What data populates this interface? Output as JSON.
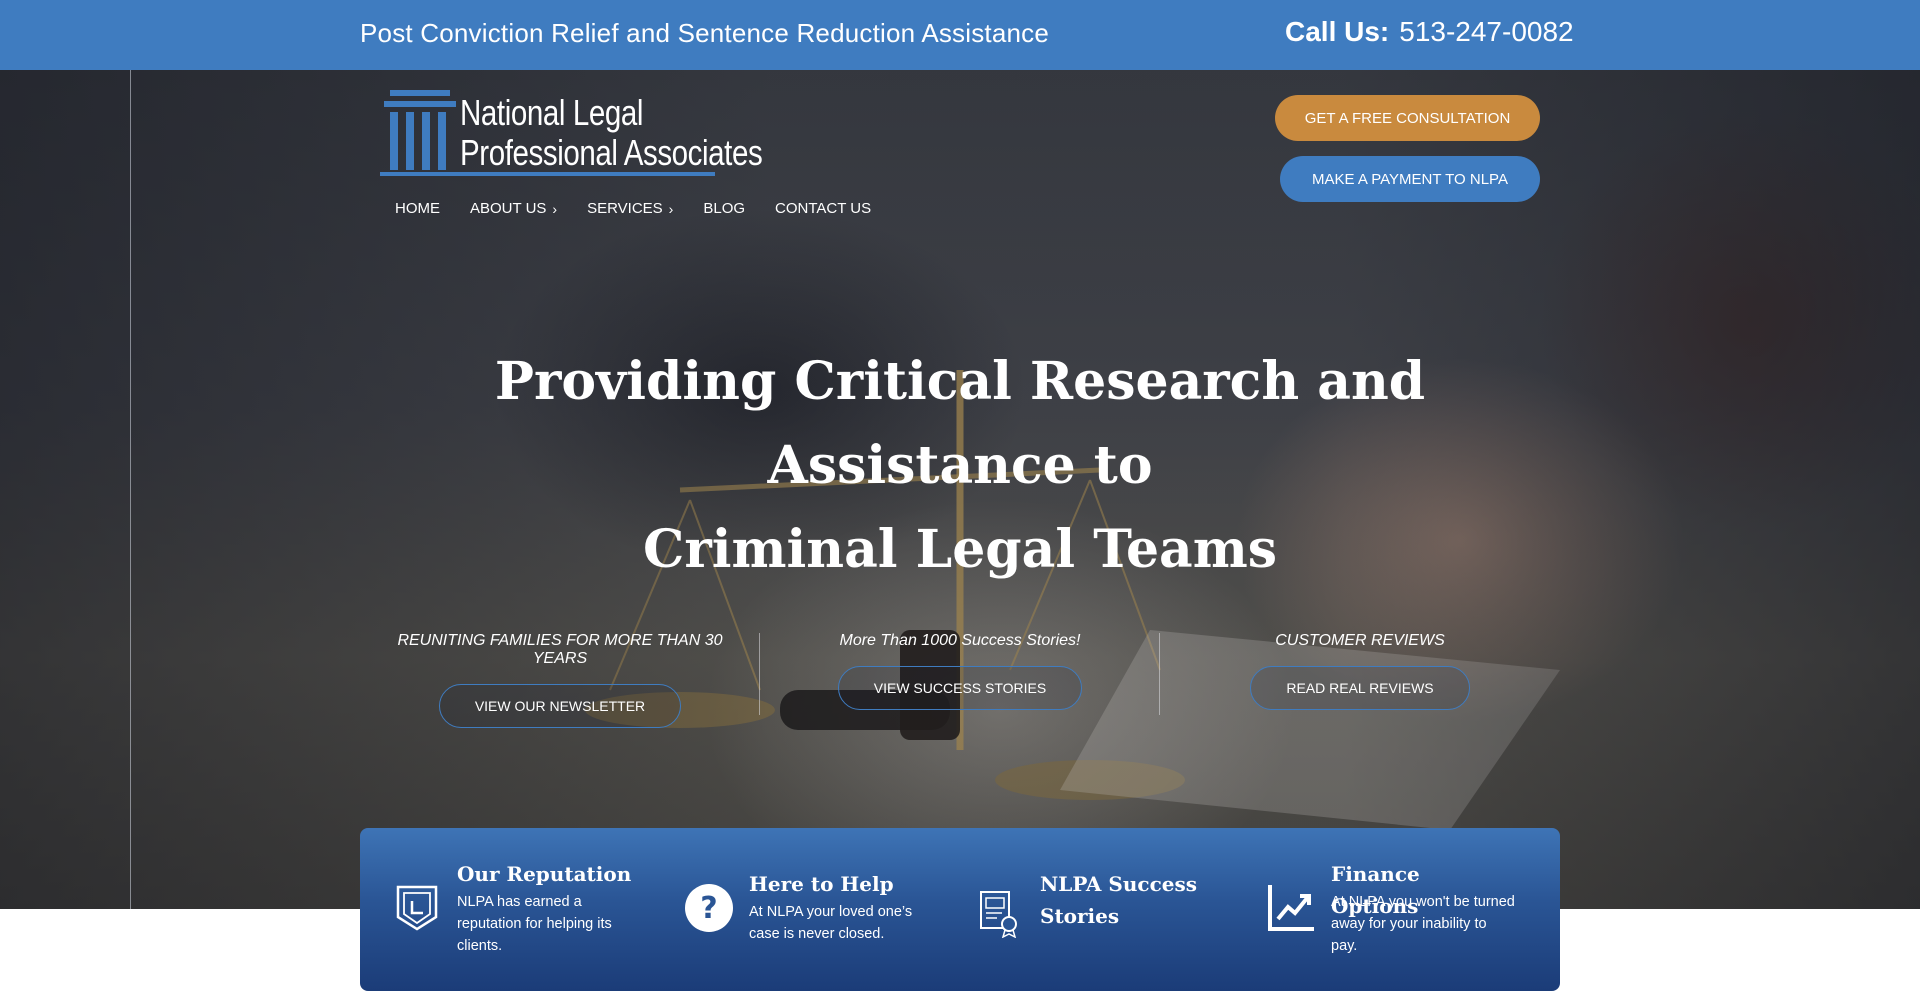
{
  "topbar": {
    "tagline": "Post Conviction Relief and Sentence Reduction Assistance",
    "call_label": "Call Us:",
    "phone": "513-247-0082"
  },
  "logo": {
    "line1": "National Legal",
    "line2": "Professional Associates"
  },
  "nav": {
    "items": [
      {
        "label": "HOME",
        "icon": ""
      },
      {
        "label": "ABOUT US",
        "icon": "chevron-right-icon"
      },
      {
        "label": "SERVICES",
        "icon": "chevron-right-icon"
      },
      {
        "label": "BLOG",
        "icon": ""
      },
      {
        "label": "CONTACT US",
        "icon": ""
      }
    ]
  },
  "buttons": {
    "consultation": "GET A FREE CONSULTATION",
    "payment": "MAKE A PAYMENT TO NLPA"
  },
  "hero": {
    "headline_line1": "Providing Critical Research and Assistance to",
    "headline_line2": "Criminal Legal Teams"
  },
  "ctas": [
    {
      "title": "REUNITING FAMILIES FOR MORE THAN 30 YEARS",
      "button": "VIEW OUR NEWSLETTER"
    },
    {
      "title": "More Than 1000 Success Stories!",
      "button": "VIEW SUCCESS STORIES"
    },
    {
      "title": "CUSTOMER REVIEWS",
      "button": "READ REAL REVIEWS"
    }
  ],
  "features": [
    {
      "icon": "shield-badge-icon",
      "title": "Our Reputation",
      "text": "NLPA has earned a reputation for helping its clients."
    },
    {
      "icon": "question-circle-icon",
      "title": "Here to Help",
      "text": "At NLPA your loved one’s case is never closed."
    },
    {
      "icon": "certificate-icon",
      "title": "NLPA Success Stories",
      "text": ""
    },
    {
      "icon": "chart-up-icon",
      "title": "Finance Options",
      "text": "At NLPA you won't be turned away for your inability to pay."
    }
  ],
  "colors": {
    "brand_blue": "#3f7cc0",
    "accent_orange": "#c98a3e",
    "feature_dark": "#1b3c78"
  }
}
